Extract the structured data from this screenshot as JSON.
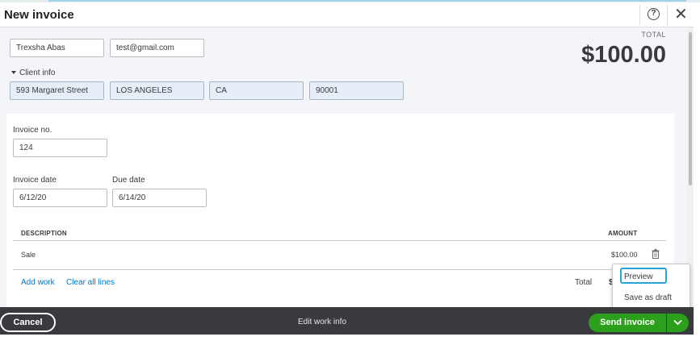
{
  "window": {
    "title": "New invoice",
    "help_icon": "help-icon",
    "help_glyph": "?",
    "close_icon": "close-icon",
    "close_glyph": "✕"
  },
  "customer": {
    "name": "Trexsha Abas",
    "email": "test@gmail.com",
    "client_info_label": "Client info",
    "street": "593  Margaret Street",
    "city": "LOS ANGELES",
    "state": "CA",
    "zip": "90001"
  },
  "summary": {
    "total_label": "TOTAL",
    "total_amount": "$100.00"
  },
  "invoice": {
    "number_label": "Invoice no.",
    "number": "124",
    "date_label": "Invoice date",
    "date": "6/12/20",
    "due_label": "Due date",
    "due": "6/14/20"
  },
  "table": {
    "headers": [
      "DESCRIPTION",
      "AMOUNT"
    ],
    "rows": [
      {
        "description": "Sale",
        "amount": "$100.00",
        "delete_icon": "trash-icon"
      }
    ]
  },
  "actions": {
    "add_work": "Add work",
    "clear_lines": "Clear all lines",
    "total_label": "Total",
    "total_partial": "$"
  },
  "popup": {
    "items": [
      "Preview",
      "Save as draft"
    ]
  },
  "footer": {
    "cancel": "Cancel",
    "edit_work": "Edit work info",
    "send": "Send invoice",
    "dropdown_icon": "chevron-down-icon"
  },
  "colors": {
    "accent_green": "#2ca01c",
    "link_blue": "#0077c5",
    "footer_bg": "#383a3e",
    "highlight_outline": "#27a4d8"
  }
}
